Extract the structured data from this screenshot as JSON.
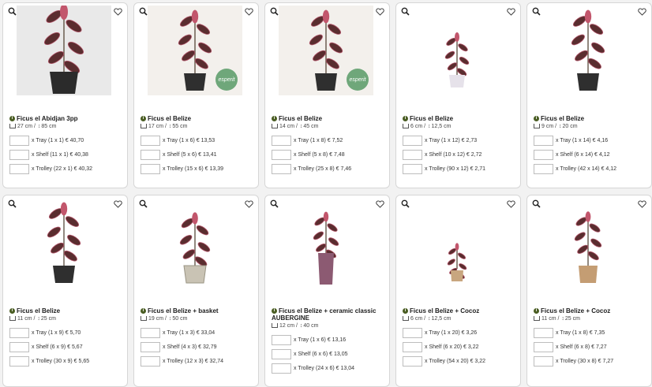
{
  "icons": {
    "zoom": "zoom-icon",
    "favorite": "heart-icon",
    "info": "info-icon",
    "pot": "pot-icon",
    "height": "height-icon"
  },
  "colors": {
    "info_badge": "#4a5d23",
    "card_border": "#d6d6d6"
  },
  "products": [
    {
      "title": "Ficus el Abidjan 3pp",
      "pot": "27 cm",
      "height": "85 cm",
      "options": [
        "x Tray (1 x 1) € 40,70",
        "x Shelf (11 x 1) € 40,38",
        "x Trolley (22 x 1) € 40,32"
      ]
    },
    {
      "title": "Ficus el Belize",
      "pot": "17 cm",
      "height": "55 cm",
      "badge": "esperit",
      "options": [
        "x Tray (1 x 6) € 13,53",
        "x Shelf (5 x 6) € 13,41",
        "x Trolley (15 x 6) € 13,39"
      ]
    },
    {
      "title": "Ficus el Belize",
      "pot": "14 cm",
      "height": "45 cm",
      "badge": "esperit",
      "options": [
        "x Tray (1 x 8) € 7,52",
        "x Shelf (5 x 8) € 7,48",
        "x Trolley (25 x 8) € 7,46"
      ]
    },
    {
      "title": "Ficus el Belize",
      "pot": "6 cm",
      "height": "12,5 cm",
      "options": [
        "x Tray (1 x 12) € 2,73",
        "x Shelf (10 x 12) € 2,72",
        "x Trolley (90 x 12) € 2,71"
      ]
    },
    {
      "title": "Ficus el Belize",
      "pot": "9 cm",
      "height": "20 cm",
      "options": [
        "x Tray (1 x 14) € 4,16",
        "x Shelf (6 x 14) € 4,12",
        "x Trolley (42 x 14) € 4,12"
      ]
    },
    {
      "title": "Ficus el Belize",
      "pot": "11 cm",
      "height": "25 cm",
      "options": [
        "x Tray (1 x 9) € 5,70",
        "x Shelf (6 x 9) € 5,67",
        "x Trolley (30 x 9) € 5,65"
      ]
    },
    {
      "title": "Ficus el Belize + basket",
      "pot": "19 cm",
      "height": "50 cm",
      "options": [
        "x Tray (1 x 3) € 33,04",
        "x Shelf (4 x 3) € 32,79",
        "x Trolley (12 x 3) € 32,74"
      ]
    },
    {
      "title": "Ficus el Belize + ceramic classic",
      "title2": "AUBERGINE",
      "pot": "12 cm",
      "height": "40 cm",
      "options": [
        "x Tray (1 x 6) € 13,16",
        "x Shelf (6 x 6) € 13,05",
        "x Trolley (24 x 6) € 13,04"
      ]
    },
    {
      "title": "Ficus el Belize + Cocoz",
      "pot": "6 cm",
      "height": "12,5 cm",
      "options": [
        "x Tray (1 x 20) € 3,26",
        "x Shelf (6 x 20) € 3,22",
        "x Trolley (54 x 20) € 3,22"
      ]
    },
    {
      "title": "Ficus el Belize + Cocoz",
      "pot": "11 cm",
      "height": "25 cm",
      "options": [
        "x Tray (1 x 8) € 7,35",
        "x Shelf (6 x 8) € 7,27",
        "x Trolley (30 x 8) € 7,27"
      ]
    }
  ]
}
